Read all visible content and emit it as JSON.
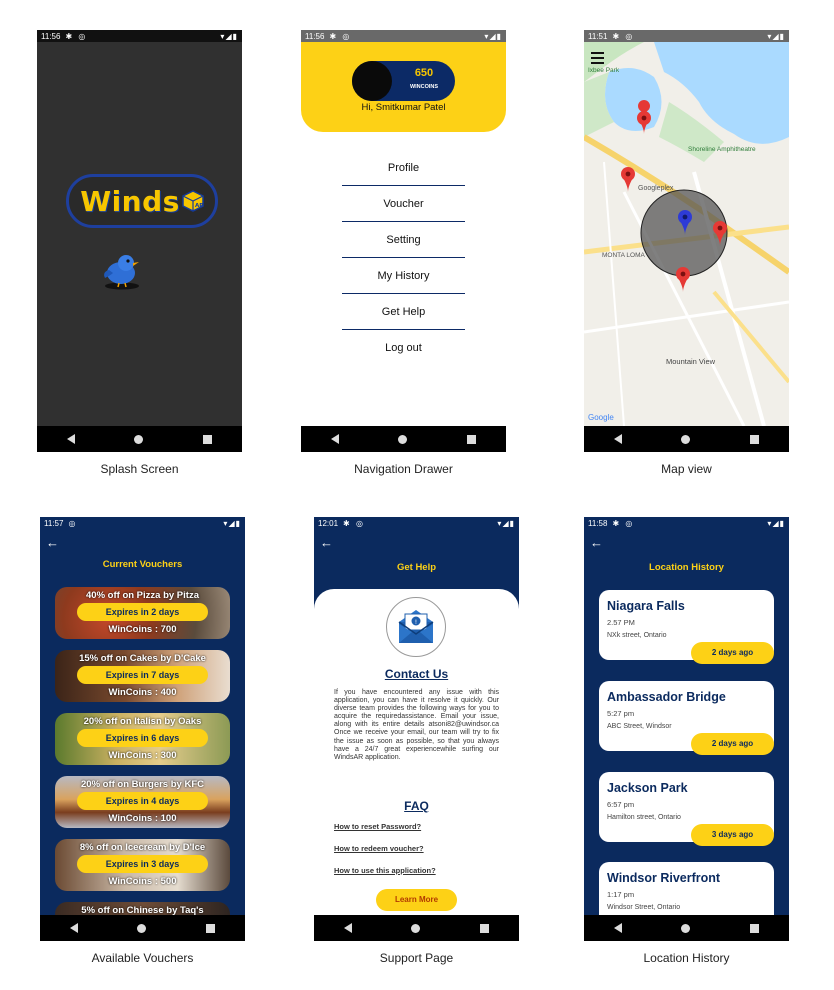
{
  "screens": {
    "splash": {
      "caption": "Splash Screen",
      "logo_text": "Winds",
      "logo_suffix": "AR",
      "status_time": "11:56"
    },
    "drawer": {
      "caption": "Navigation Drawer",
      "status_time": "11:56",
      "coins_value": "650",
      "coins_label": "WINCOINS",
      "greeting": "Hi, Smitkumar Patel",
      "menu": [
        "Profile",
        "Voucher",
        "Setting",
        "My History",
        "Get Help",
        "Log out"
      ]
    },
    "map": {
      "caption": "Map view",
      "status_time": "11:51",
      "labels": {
        "park": "Ixbee Park",
        "amphitheatre": "Shoreline Amphitheatre",
        "googleplex": "Googleplex",
        "monta_loma": "MONTA LOMA",
        "mountain_view": "Mountain View",
        "google": "Google"
      }
    },
    "vouchers": {
      "caption": "Available Vouchers",
      "status_time": "11:57",
      "title": "Current Vouchers",
      "items": [
        {
          "title": "40% off on Pizza by Pitza",
          "expires": "Expires in 2 days",
          "coins": "WinCoins : 700"
        },
        {
          "title": "15% off on Cakes by D'Cake",
          "expires": "Expires in 7 days",
          "coins": "WinCoins : 400"
        },
        {
          "title": "20% off on Italisn by Oaks",
          "expires": "Expires in 6 days",
          "coins": "WinCoins : 300"
        },
        {
          "title": "20% off on Burgers by KFC",
          "expires": "Expires in 4 days",
          "coins": "WinCoins : 100"
        },
        {
          "title": "8% off on Icecream by D'Ice",
          "expires": "Expires in 3 days",
          "coins": "WinCoins : 500"
        },
        {
          "title": "5% off on Chinese by Taq's",
          "expires": "",
          "coins": ""
        }
      ]
    },
    "support": {
      "caption": "Support Page",
      "status_time": "12:01",
      "title": "Get Help",
      "contact_title": "Contact Us",
      "body": "If you have encountered any issue with this application, you can have it resolve it quickly. Our diverse team provides the following ways for you to acquire the requiredassistance. Email your issue, along with its entire details atsoni82@uwindsor.ca Once we receive your email, our team will try to fix the issue as soon as possible, so that you always have a 24/7 great experiencewhile surfing our WindsAR application.",
      "faq_title": "FAQ",
      "faq": [
        "How to reset Password?",
        "How to redeem voucher?",
        "How to use this application?"
      ],
      "button": "Learn More"
    },
    "history": {
      "caption": "Location History",
      "status_time": "11:58",
      "title": "Location History",
      "items": [
        {
          "place": "Niagara Falls",
          "time": "2.57 PM",
          "address": "NXk street, Ontario",
          "ago": "2 days ago"
        },
        {
          "place": "Ambassador Bridge",
          "time": "5:27 pm",
          "address": "ABC Street, Windsor",
          "ago": "2 days ago"
        },
        {
          "place": "Jackson Park",
          "time": "6:57 pm",
          "address": "Hamilton street, Ontario",
          "ago": "3 days ago"
        },
        {
          "place": "Windsor Riverfront",
          "time": "1:17 pm",
          "address": "Windsor Street, Ontario",
          "ago": ""
        }
      ]
    }
  },
  "colors": {
    "navy": "#0b2a5e",
    "yellow": "#fdd116",
    "splash_bg": "#303030",
    "marker_red": "#e53935",
    "marker_blue": "#2e3bd6"
  }
}
